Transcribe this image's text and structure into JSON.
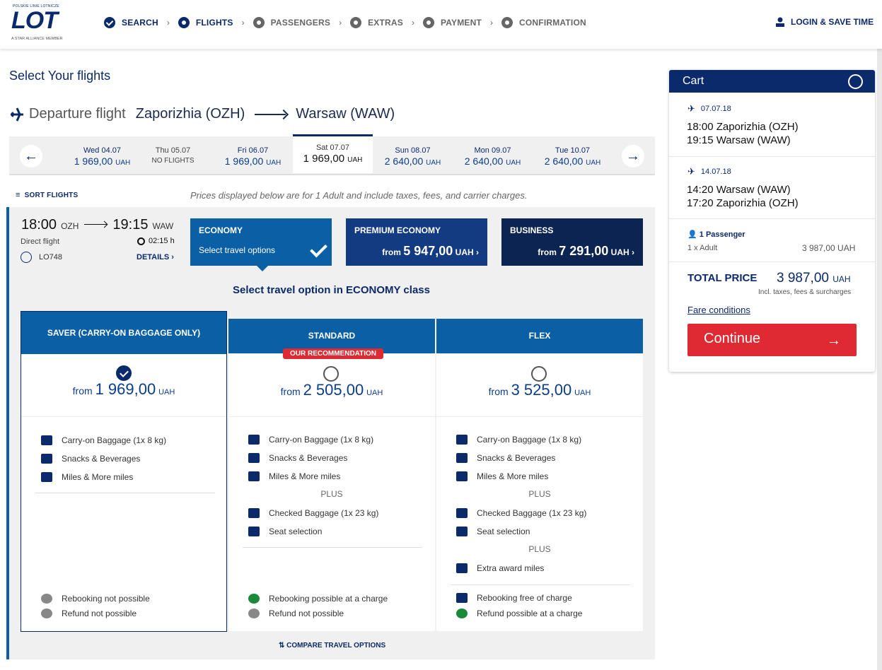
{
  "header": {
    "logo_tag": "POLSKIE LINIE LOTNICZE",
    "logo": "LOT",
    "logo_sub": "A STAR ALLIANCE MEMBER",
    "steps": [
      "SEARCH",
      "FLIGHTS",
      "PASSENGERS",
      "EXTRAS",
      "PAYMENT",
      "CONFIRMATION"
    ],
    "login": "LOGIN & SAVE TIME"
  },
  "page": {
    "title": "Select Your flights",
    "dep_label": "Departure flight",
    "from": "Zaporizhia (OZH)",
    "to": "Warsaw (WAW)"
  },
  "dates": [
    {
      "day": "Wed 04.07",
      "price": "1 969,00",
      "cur": "UAH"
    },
    {
      "day": "Thu 05.07",
      "price": "NO FLIGHTS",
      "cur": ""
    },
    {
      "day": "Fri 06.07",
      "price": "1 969,00",
      "cur": "UAH"
    },
    {
      "day": "Sat 07.07",
      "price": "1 969,00",
      "cur": "UAH"
    },
    {
      "day": "Sun 08.07",
      "price": "2 640,00",
      "cur": "UAH"
    },
    {
      "day": "Mon 09.07",
      "price": "2 640,00",
      "cur": "UAH"
    },
    {
      "day": "Tue 10.07",
      "price": "2 640,00",
      "cur": "UAH"
    }
  ],
  "sort": "SORT FLIGHTS",
  "note": "Prices displayed below are for 1 Adult and include taxes, fees, and carrier charges.",
  "flight": {
    "dep_time": "18:00",
    "dep_code": "OZH",
    "arr_time": "19:15",
    "arr_code": "WAW",
    "direct": "Direct flight",
    "duration": "02:15 h",
    "number": "LO748",
    "details": "DETAILS"
  },
  "classes": {
    "economy": {
      "name": "ECONOMY",
      "sub": "Select travel options"
    },
    "premium": {
      "name": "PREMIUM ECONOMY",
      "from": "from",
      "price": "5 947,00",
      "cur": "UAH"
    },
    "business": {
      "name": "BUSINESS",
      "from": "from",
      "price": "7 291,00",
      "cur": "UAH"
    }
  },
  "select_option": "Select travel option in ECONOMY class",
  "fares": {
    "saver": {
      "name": "SAVER (CARRY-ON BAGGAGE ONLY)",
      "from": "from",
      "price": "1 969,00",
      "cur": "UAH"
    },
    "standard": {
      "name": "STANDARD",
      "badge": "OUR RECOMMENDATION",
      "from": "from",
      "price": "2 505,00",
      "cur": "UAH"
    },
    "flex": {
      "name": "FLEX",
      "from": "from",
      "price": "3 525,00",
      "cur": "UAH"
    }
  },
  "features": {
    "carry": "Carry-on Baggage (1x 8 kg)",
    "snacks": "Snacks & Beverages",
    "miles": "Miles & More miles",
    "plus": "PLUS",
    "checked": "Checked Baggage (1x 23 kg)",
    "seat": "Seat selection",
    "award": "Extra award miles",
    "rebook_no": "Rebooking not possible",
    "refund_no": "Refund not possible",
    "rebook_charge": "Rebooking possible at a charge",
    "rebook_free": "Rebooking free of charge",
    "refund_charge": "Refund possible at a charge"
  },
  "compare": "COMPARE TRAVEL OPTIONS",
  "cart": {
    "title": "Cart",
    "seg1": {
      "date": "07.07.18",
      "l1": "18:00 Zaporizhia (OZH)",
      "l2": "19:15 Warsaw (WAW)"
    },
    "seg2": {
      "date": "14.07.18",
      "l1": "14:20 Warsaw (WAW)",
      "l2": "17:20 Zaporizhia (OZH)"
    },
    "pax": "1 Passenger",
    "pax_line": "1 x Adult",
    "pax_price": "3 987,00 UAH",
    "total_label": "TOTAL PRICE",
    "total": "3 987,00",
    "cur": "UAH",
    "incl": "Incl. taxes, fees & surcharges",
    "fare_conditions": "Fare conditions",
    "continue": "Continue"
  }
}
